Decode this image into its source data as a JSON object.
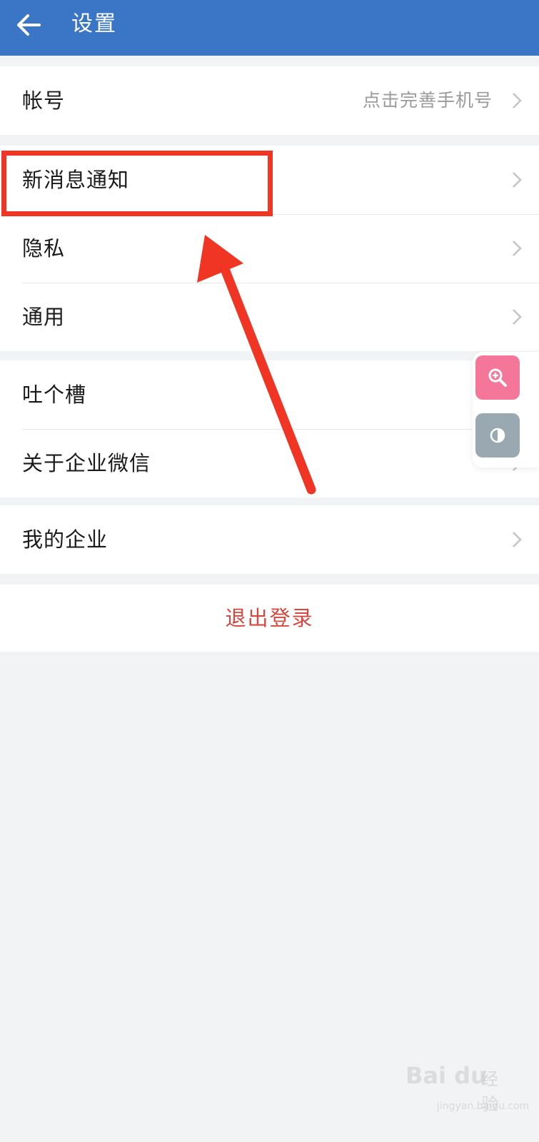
{
  "header": {
    "title": "设置",
    "back_icon": "arrow-left-icon",
    "background": "#3b76c6"
  },
  "groups": [
    {
      "items": [
        {
          "label": "帐号",
          "hint": "点击完善手机号"
        }
      ]
    },
    {
      "items": [
        {
          "label": "新消息通知"
        },
        {
          "label": "隐私"
        },
        {
          "label": "通用"
        }
      ]
    },
    {
      "items": [
        {
          "label": "吐个槽"
        },
        {
          "label": "关于企业微信"
        }
      ]
    },
    {
      "items": [
        {
          "label": "我的企业"
        }
      ]
    }
  ],
  "logout": {
    "label": "退出登录",
    "color": "#d6473e"
  },
  "annotation": {
    "color": "#f03524",
    "highlighted_item": "新消息通知"
  },
  "floating_tools": [
    {
      "name": "zoom-in-icon",
      "color": "#f47799"
    },
    {
      "name": "contrast-icon",
      "color": "#9aa9b1"
    }
  ],
  "watermark": {
    "brand": "Bai du",
    "sub": "经验",
    "url": "jingyan.baidu.com"
  }
}
